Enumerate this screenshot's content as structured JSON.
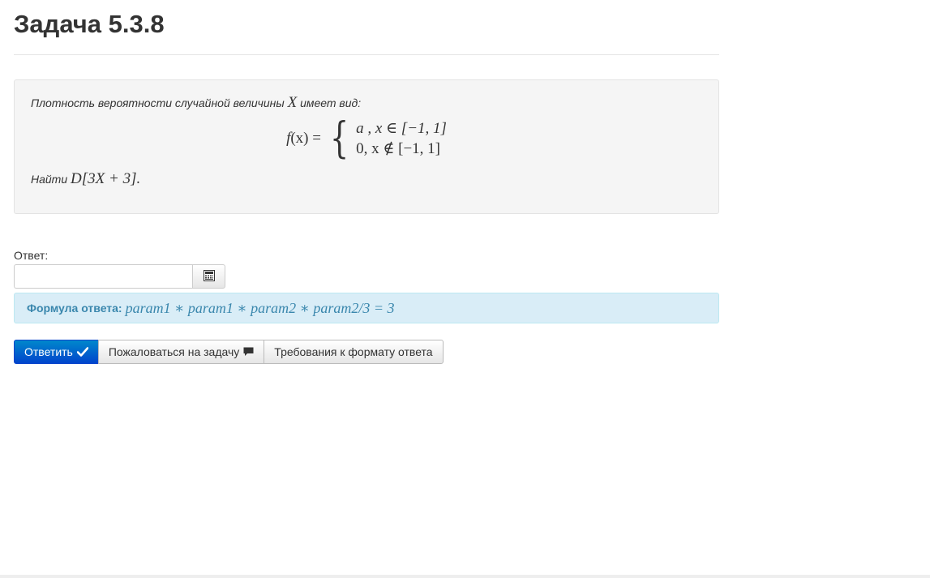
{
  "problem": {
    "title": "Задача 5.3.8",
    "statement_intro": "Плотность вероятности случайной величины",
    "variable": "X",
    "statement_suffix": "имеет вид:",
    "formula_lhs_func": "f",
    "formula_lhs_arg": "(x) =",
    "case1": "a ,  x ∈ [−1, 1]",
    "case2": "0, x ∉ [−1, 1]",
    "find_label": "Найти",
    "find_expr": "D[3X + 3]."
  },
  "answer": {
    "label": "Ответ:",
    "input_value": "",
    "input_placeholder": ""
  },
  "formula_hint": {
    "label": "Формула ответа:",
    "expression": "param1 ∗ param1 ∗ param2 ∗ param2/3 = 3"
  },
  "buttons": {
    "submit_label": "Ответить",
    "complain_label": "Пожаловаться на задачу",
    "requirements_label": "Требования к формату ответа"
  },
  "icons": {
    "calculator": "calculator-icon",
    "check": "check-icon",
    "comment": "comment-icon"
  },
  "colors": {
    "primary": "#0055cc",
    "info_bg": "#d9edf7",
    "info_text": "#3a87ad",
    "box_bg": "#f5f5f5"
  }
}
